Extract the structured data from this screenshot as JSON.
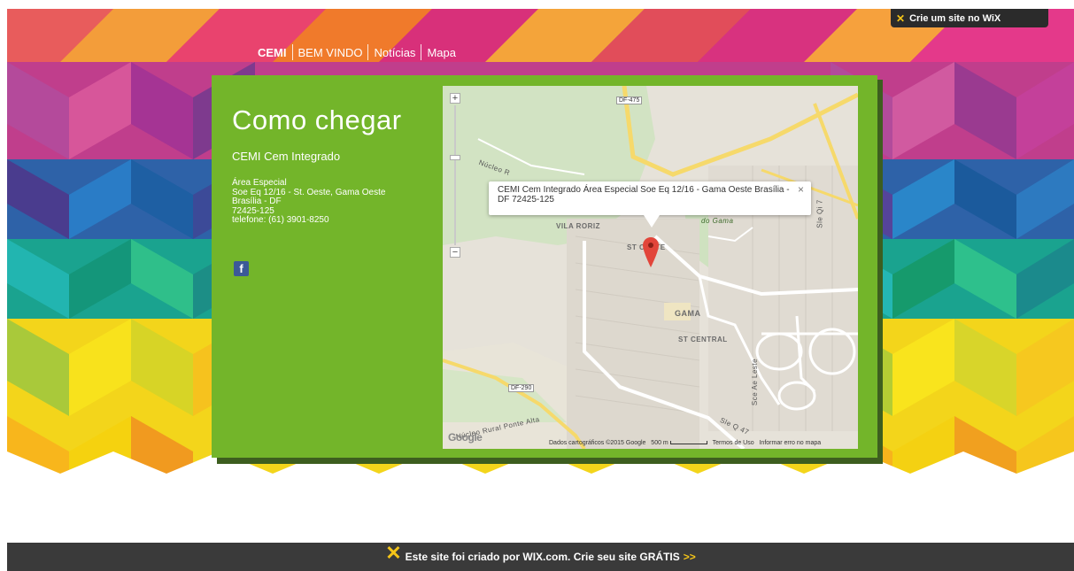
{
  "nav": {
    "items": [
      {
        "label": "CEMI"
      },
      {
        "label": "BEM VINDO"
      },
      {
        "label": "Notícias"
      },
      {
        "label": "Mapa"
      }
    ]
  },
  "wix_top": {
    "label": "Crie um site no WiX",
    "icon": "wix-logo-icon"
  },
  "content": {
    "title": "Como chegar",
    "subtitle": "CEMI Cem Integrado",
    "address_lines": [
      "Área Especial",
      "Soe Eq 12/16 - St. Oeste, Gama Oeste",
      "Brasília - DF",
      "72425-125",
      "telefone: (61) 3901-8250"
    ],
    "facebook_icon": "f"
  },
  "map": {
    "info_window": "CEMI Cem Integrado Área Especial Soe Eq 12/16 - Gama Oeste Brasília - DF 72425-125",
    "close_label": "×",
    "zoom_in": "+",
    "zoom_out": "−",
    "labels": {
      "vila_roriz": "VILA RORIZ",
      "st_oeste": "ST OESTE",
      "gama": "GAMA",
      "st_central": "ST CENTRAL",
      "do_gama": "do Gama",
      "nucleo": "Núcleo R",
      "nucleo_rural": "Núcleo Rural Ponte Alta",
      "sqe_ae_leste": "Sce Ae Leste",
      "sle_qi7": "Sle Qi 7",
      "sle_q47": "Sle Q 47"
    },
    "roads": {
      "df475": "DF-475",
      "df290": "DF-290"
    },
    "google": "Google",
    "footer": {
      "data": "Dados cartográficos ©2015 Google",
      "scale": "500 m",
      "terms": "Termos de Uso",
      "report": "Informar erro no mapa"
    }
  },
  "wix_bottom": {
    "text": "Este site foi criado por WIX.com. Crie seu site GRÁTIS",
    "arrows": ">>"
  },
  "colors": {
    "card_green": "#73b52a",
    "card_shadow": "#3d5e1f",
    "wix_dark": "#3a3a3a",
    "wix_yellow": "#f5c518"
  }
}
